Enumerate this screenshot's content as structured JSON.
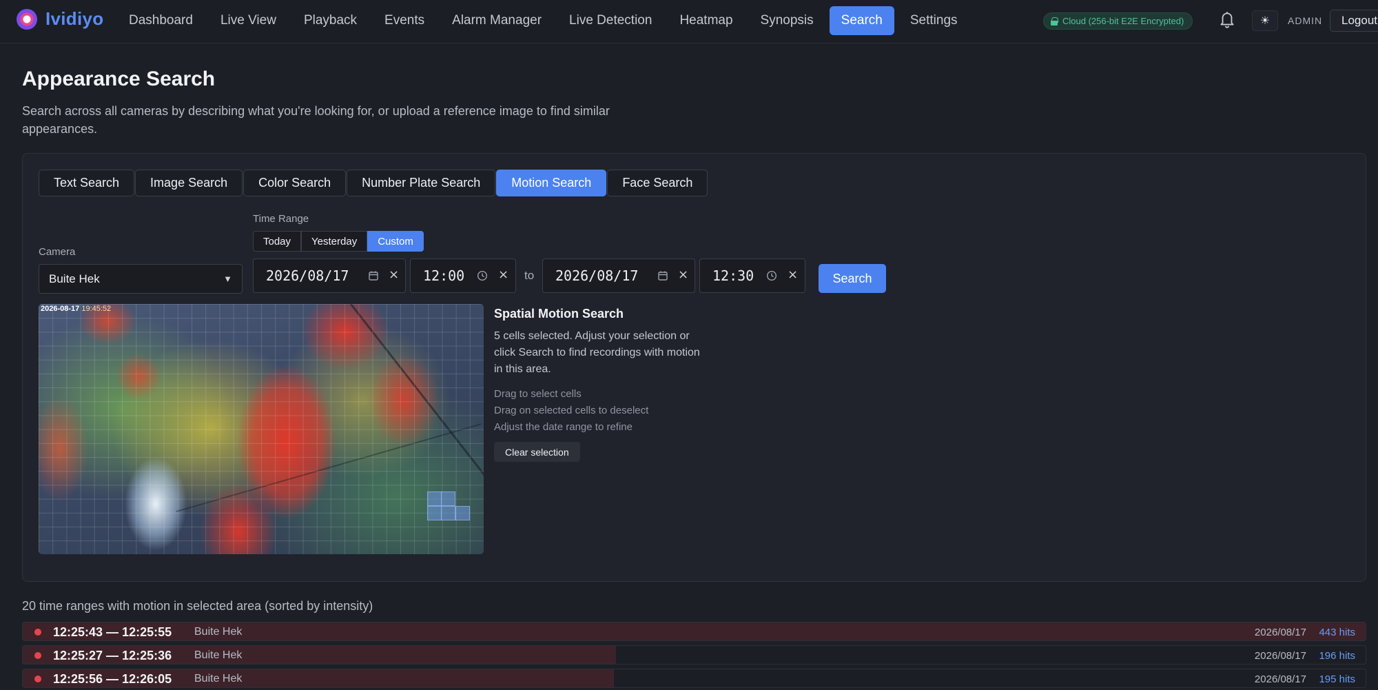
{
  "app": {
    "name": "Ividiyo"
  },
  "nav": {
    "items": [
      {
        "label": "Dashboard"
      },
      {
        "label": "Live View"
      },
      {
        "label": "Playback"
      },
      {
        "label": "Events"
      },
      {
        "label": "Alarm Manager"
      },
      {
        "label": "Live Detection"
      },
      {
        "label": "Heatmap"
      },
      {
        "label": "Synopsis"
      },
      {
        "label": "Search",
        "active": true
      },
      {
        "label": "Settings"
      }
    ]
  },
  "header": {
    "cloud_status": "Cloud (256-bit E2E Encrypted)",
    "theme_icon": "☀",
    "user": "ADMIN",
    "logout_label": "Logout"
  },
  "page": {
    "title": "Appearance Search",
    "description": "Search across all cameras by describing what you're looking for, or upload a reference image to find similar appearances."
  },
  "tabs": [
    {
      "label": "Text Search"
    },
    {
      "label": "Image Search"
    },
    {
      "label": "Color Search"
    },
    {
      "label": "Number Plate Search"
    },
    {
      "label": "Motion Search",
      "active": true
    },
    {
      "label": "Face Search"
    }
  ],
  "filters": {
    "camera_label": "Camera",
    "camera_value": "Buite Hek",
    "time_range_label": "Time Range",
    "range_options": [
      {
        "label": "Today"
      },
      {
        "label": "Yesterday"
      },
      {
        "label": "Custom",
        "active": true
      }
    ],
    "start_date": "2026/08/17",
    "start_time": "12:00",
    "to_label": "to",
    "end_date": "2026/08/17",
    "end_time": "12:30",
    "search_label": "Search"
  },
  "heatmap": {
    "timestamp_date": "2026-08-17",
    "timestamp_time": "19:45:52",
    "selected_cells": 5
  },
  "spatial": {
    "title": "Spatial Motion Search",
    "text": "5 cells selected. Adjust your selection or click Search to find recordings with motion in this area.",
    "hints": [
      "Drag to select cells",
      "Drag on selected cells to deselect",
      "Adjust the date range to refine"
    ],
    "clear_label": "Clear selection"
  },
  "results": {
    "summary": "20 time ranges with motion in selected area (sorted by intensity)",
    "rows": [
      {
        "time": "12:25:43 — 12:25:55",
        "camera": "Buite Hek",
        "date": "2026/08/17",
        "hits": "443 hits",
        "intensity": 1.0
      },
      {
        "time": "12:25:27 — 12:25:36",
        "camera": "Buite Hek",
        "date": "2026/08/17",
        "hits": "196 hits",
        "intensity": 0.442
      },
      {
        "time": "12:25:56 — 12:26:05",
        "camera": "Buite Hek",
        "date": "2026/08/17",
        "hits": "195 hits",
        "intensity": 0.44
      }
    ]
  },
  "colors": {
    "accent": "#4c82ef",
    "cloud_ok": "#4fc39a",
    "result_dot": "#e4464e",
    "hits_text": "#6a9cf5"
  }
}
